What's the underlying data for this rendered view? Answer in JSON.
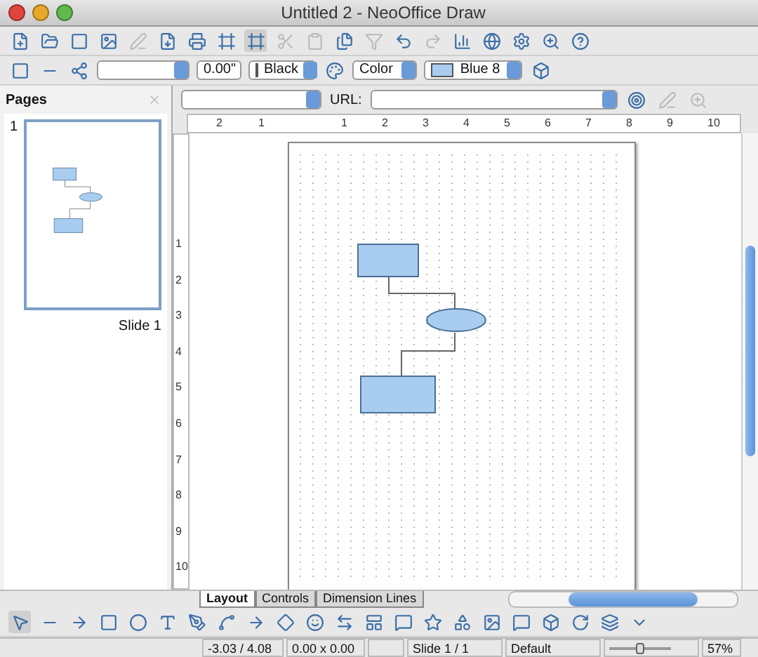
{
  "window": {
    "title": "Untitled 2 - NeoOffice Draw"
  },
  "line_toolbar": {
    "line_width": "0.00\"",
    "line_color": "Black",
    "area_style": "Color",
    "area_fill": "Blue 8"
  },
  "pages_panel": {
    "title": "Pages",
    "pages": [
      {
        "number": "1",
        "label": "Slide 1",
        "selected": true
      }
    ]
  },
  "hyperlink_bar": {
    "url_label": "URL:"
  },
  "ruler": {
    "horizontal": [
      "2",
      "1",
      "1",
      "2",
      "3",
      "4",
      "5",
      "6",
      "7",
      "8",
      "9",
      "10"
    ],
    "vertical": [
      "1",
      "2",
      "3",
      "4",
      "5",
      "6",
      "7",
      "8",
      "9",
      "10"
    ]
  },
  "tabs": [
    {
      "label": "Layout",
      "selected": true
    },
    {
      "label": "Controls",
      "selected": false
    },
    {
      "label": "Dimension Lines",
      "selected": false
    }
  ],
  "status_bar": {
    "position": "-3.03 / 4.08",
    "size": "0.00 x 0.00",
    "slide": "Slide 1 / 1",
    "layout": "Default",
    "zoom_slider": {
      "level": 0.5
    },
    "zoom": "57%"
  }
}
